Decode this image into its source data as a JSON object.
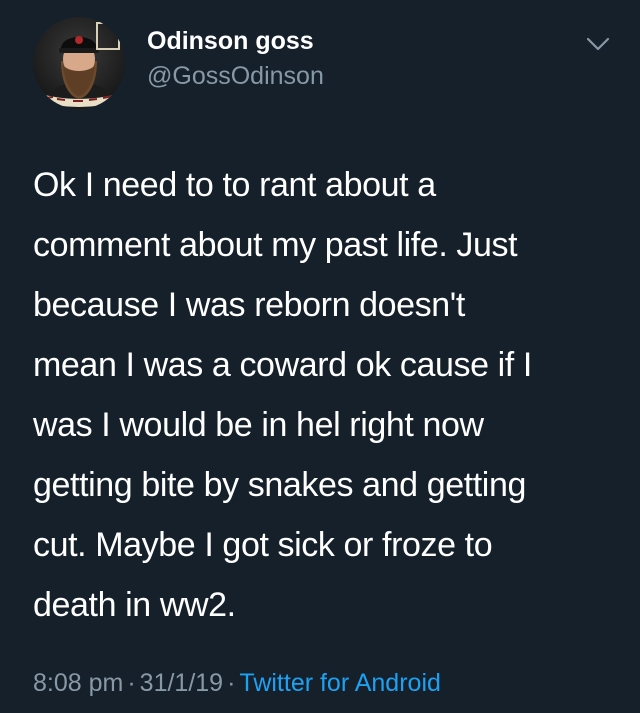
{
  "user": {
    "display_name": "Odinson goss",
    "handle": "@GossOdinson",
    "avatar_icon": "profile-photo"
  },
  "tweet": {
    "text": "Ok I need to to rant about a\ncomment about my past life. Just\nbecause I was reborn doesn't\nmean I was a coward ok cause if I\nwas I would be in hel right now\ngetting bite by snakes and getting\ncut. Maybe I got sick or froze to\ndeath in ww2.",
    "time": "8:08 pm",
    "date": "31/1/19",
    "source": "Twitter for Android"
  },
  "colors": {
    "background": "#15202b",
    "text_primary": "#ffffff",
    "text_muted": "#8899a6",
    "link": "#1da1f2"
  },
  "icons": {
    "menu": "chevron-down-icon"
  }
}
